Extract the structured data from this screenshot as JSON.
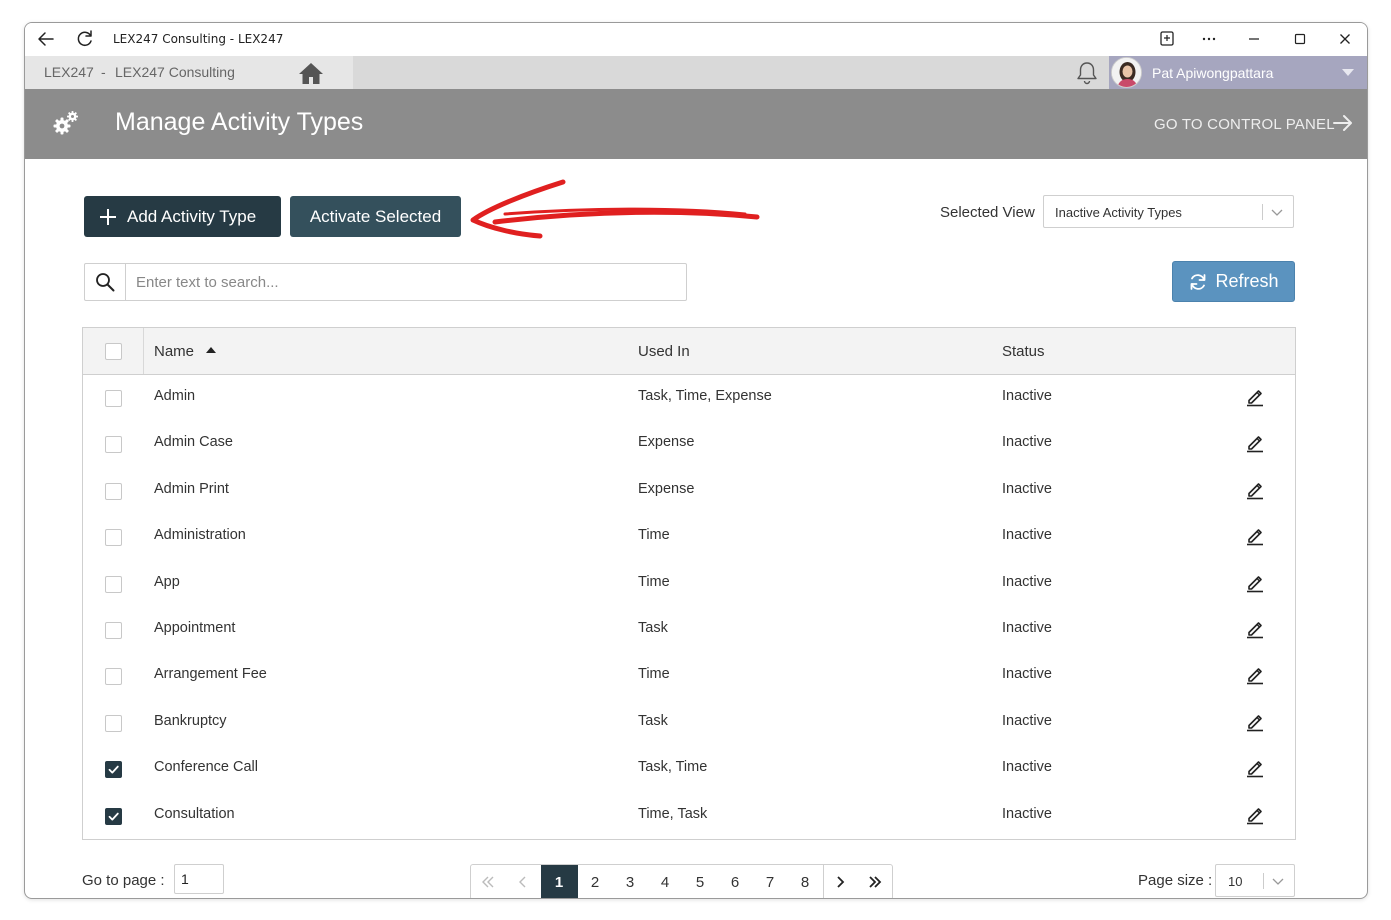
{
  "window": {
    "title": "LEX247 Consulting - LEX247",
    "icons": [
      "back-arrow-icon",
      "reload-icon",
      "cast-icon",
      "more-icon",
      "minimize-icon",
      "maximize-icon",
      "close-icon"
    ]
  },
  "app_header": {
    "brand": "LEX247",
    "separator": "-",
    "firm": "LEX247 Consulting",
    "user_name": "Pat Apiwongpattara"
  },
  "banner": {
    "title": "Manage Activity Types",
    "control_panel_link": "GO TO CONTROL PANEL"
  },
  "toolbar": {
    "add_label": "Add Activity Type",
    "activate_label": "Activate Selected",
    "selected_view_label": "Selected View",
    "selected_view_value": "Inactive Activity Types",
    "search_placeholder": "Enter text to search...",
    "refresh_label": "Refresh"
  },
  "grid": {
    "columns": [
      "Name",
      "Used In",
      "Status"
    ],
    "sort_column": "Name",
    "sort_direction": "ascending",
    "rows": [
      {
        "name": "Admin",
        "used_in": "Task, Time, Expense",
        "status": "Inactive",
        "checked": false
      },
      {
        "name": "Admin Case",
        "used_in": "Expense",
        "status": "Inactive",
        "checked": false
      },
      {
        "name": "Admin Print",
        "used_in": "Expense",
        "status": "Inactive",
        "checked": false
      },
      {
        "name": "Administration",
        "used_in": "Time",
        "status": "Inactive",
        "checked": false
      },
      {
        "name": "App",
        "used_in": "Time",
        "status": "Inactive",
        "checked": false
      },
      {
        "name": "Appointment",
        "used_in": "Task",
        "status": "Inactive",
        "checked": false
      },
      {
        "name": "Arrangement Fee",
        "used_in": "Time",
        "status": "Inactive",
        "checked": false
      },
      {
        "name": "Bankruptcy",
        "used_in": "Task",
        "status": "Inactive",
        "checked": false
      },
      {
        "name": "Conference Call",
        "used_in": "Task, Time",
        "status": "Inactive",
        "checked": true
      },
      {
        "name": "Consultation",
        "used_in": "Time, Task",
        "status": "Inactive",
        "checked": true
      }
    ]
  },
  "footer": {
    "goto_label": "Go to page :",
    "goto_value": "1",
    "pages": [
      "1",
      "2",
      "3",
      "4",
      "5",
      "6",
      "7",
      "8"
    ],
    "current_page": "1",
    "page_size_label": "Page size :",
    "page_size_value": "10"
  },
  "colors": {
    "primary_dark": "#263a44",
    "activate_button": "#34505c",
    "refresh_button": "#5b93bf",
    "banner": "#8c8c8c",
    "user_bar": "#a6a6bf",
    "annotation_arrow": "#e02020"
  }
}
